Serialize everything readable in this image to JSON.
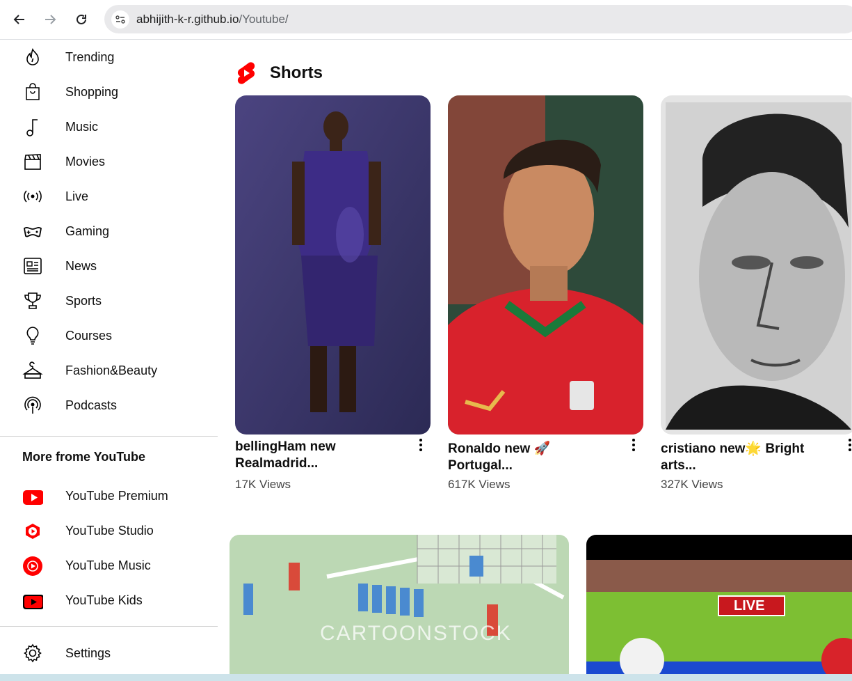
{
  "browser": {
    "url_host": "abhijith-k-r.github.io",
    "url_path": "/Youtube/"
  },
  "sidebar": {
    "explore": [
      {
        "label": "Trending",
        "icon": "trending-icon"
      },
      {
        "label": "Shopping",
        "icon": "shopping-bag-icon"
      },
      {
        "label": "Music",
        "icon": "music-note-icon"
      },
      {
        "label": "Movies",
        "icon": "clapperboard-icon"
      },
      {
        "label": "Live",
        "icon": "live-broadcast-icon"
      },
      {
        "label": "Gaming",
        "icon": "gamepad-icon"
      },
      {
        "label": "News",
        "icon": "newspaper-icon"
      },
      {
        "label": "Sports",
        "icon": "trophy-icon"
      },
      {
        "label": "Courses",
        "icon": "lightbulb-icon"
      },
      {
        "label": "Fashion&Beauty",
        "icon": "hanger-icon"
      },
      {
        "label": "Podcasts",
        "icon": "podcast-icon"
      }
    ],
    "more_title": "More frome YouTube",
    "more": [
      {
        "label": "YouTube Premium",
        "icon": "youtube-premium-icon"
      },
      {
        "label": "YouTube Studio",
        "icon": "youtube-studio-icon"
      },
      {
        "label": "YouTube Music",
        "icon": "youtube-music-icon"
      },
      {
        "label": "YouTube Kids",
        "icon": "youtube-kids-icon"
      }
    ],
    "settings_label": "Settings"
  },
  "shorts": {
    "title": "Shorts",
    "items": [
      {
        "title_line1": "bellingHam new",
        "title_line2": "Realmadrid...",
        "views": "17K Views"
      },
      {
        "title_line1": "Ronaldo new 🚀",
        "title_line2": "Portugal...",
        "views": "617K Views"
      },
      {
        "title_line1": "cristiano new🌟 Bright",
        "title_line2": "arts...",
        "views": "327K Views"
      }
    ]
  },
  "videos": {
    "watermark": "CARTOONSTOCK",
    "live_badge": "LIVE"
  },
  "colors": {
    "youtube_red": "#ff0000",
    "address_bg": "#e9e9eb"
  }
}
